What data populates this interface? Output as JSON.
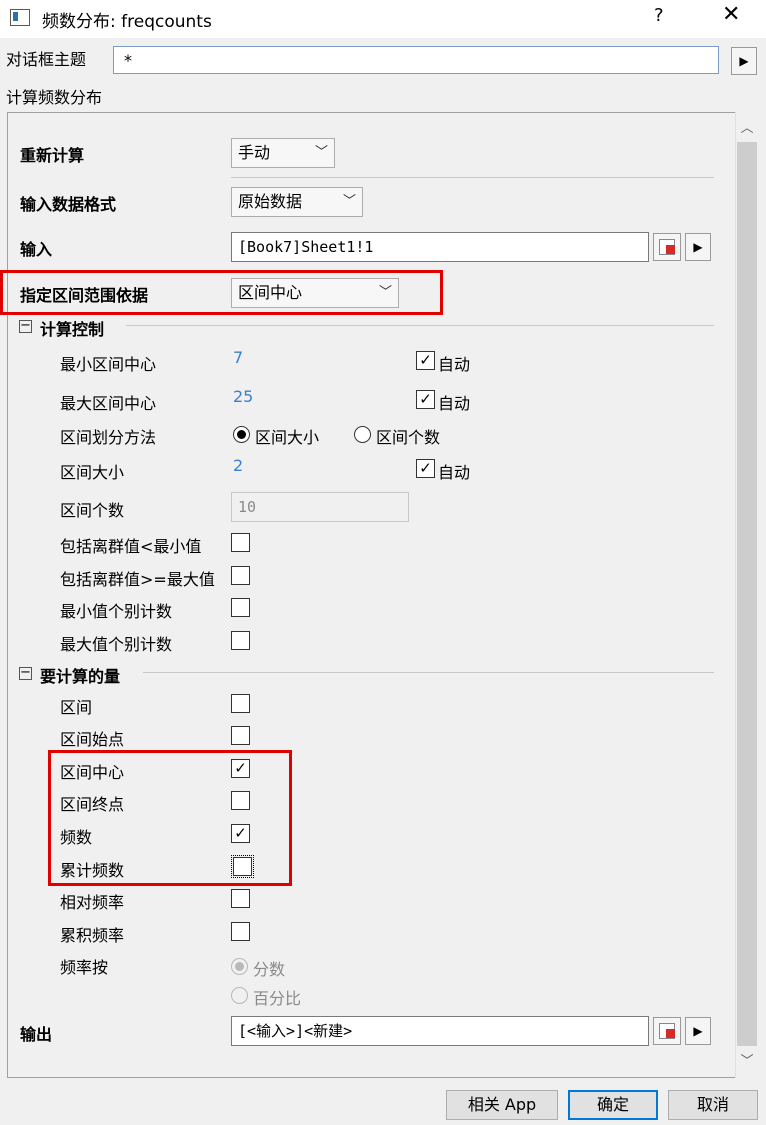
{
  "window": {
    "title": "频数分布: freqcounts",
    "help": "?",
    "close": "✕"
  },
  "theme": {
    "label": "对话框主题",
    "value": "*",
    "arrow": "▶"
  },
  "desc": "计算频数分布",
  "rows": {
    "recalc": {
      "label": "重新计算",
      "value": "手动"
    },
    "input_format": {
      "label": "输入数据格式",
      "value": "原始数据"
    },
    "input": {
      "label": "输入",
      "value": "[Book7]Sheet1!1"
    },
    "range_basis": {
      "label": "指定区间范围依据",
      "value": "区间中心"
    }
  },
  "calc_control": {
    "header": "计算控制",
    "toggle": "⊟",
    "min_center": {
      "label": "最小区间中心",
      "value": "7",
      "auto": "自动"
    },
    "max_center": {
      "label": "最大区间中心",
      "value": "25",
      "auto": "自动"
    },
    "method": {
      "label": "区间划分方法",
      "opt1": "区间大小",
      "opt2": "区间个数",
      "selected": "区间大小"
    },
    "size": {
      "label": "区间大小",
      "value": "2",
      "auto": "自动"
    },
    "count": {
      "label": "区间个数",
      "value": "10"
    },
    "outlier_low": {
      "label": "包括离群值<最小值",
      "checked": false
    },
    "outlier_high": {
      "label": "包括离群值>=最大值",
      "checked": false
    },
    "min_separate": {
      "label": "最小值个别计数",
      "checked": false
    },
    "max_separate": {
      "label": "最大值个别计数",
      "checked": false
    }
  },
  "quantities": {
    "header": "要计算的量",
    "toggle": "⊟",
    "bin": {
      "label": "区间",
      "checked": false
    },
    "bin_start": {
      "label": "区间始点",
      "checked": false
    },
    "bin_center": {
      "label": "区间中心",
      "checked": true
    },
    "bin_end": {
      "label": "区间终点",
      "checked": false
    },
    "count": {
      "label": "频数",
      "checked": true
    },
    "cum_count": {
      "label": "累计频数",
      "checked": false
    },
    "rel_freq": {
      "label": "相对频率",
      "checked": false
    },
    "cum_freq": {
      "label": "累积频率",
      "checked": false
    },
    "freq_by": {
      "label": "频率按",
      "opt1": "分数",
      "opt2": "百分比",
      "selected": "分数"
    }
  },
  "output": {
    "label": "输出",
    "value": "[<输入>]<新建>"
  },
  "buttons": {
    "app": "相关 App",
    "ok": "确定",
    "cancel": "取消"
  },
  "colors": {
    "highlight": "#e00000",
    "value_blue": "#3a7fd0"
  }
}
